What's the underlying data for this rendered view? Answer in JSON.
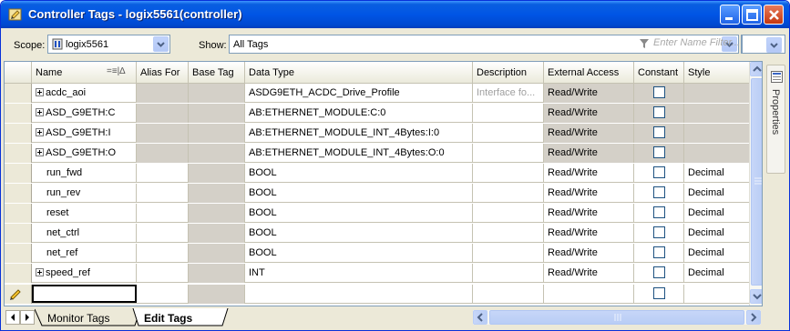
{
  "window": {
    "title": "Controller Tags - logix5561(controller)"
  },
  "toolbar": {
    "scope_label": "Scope:",
    "scope_value": "logix5561",
    "show_label": "Show:",
    "show_value": "All Tags",
    "filter_placeholder": "Enter Name Filter..."
  },
  "grid": {
    "columns": [
      "Name",
      "Alias For",
      "Base Tag",
      "Data Type",
      "Description",
      "External Access",
      "Constant",
      "Style"
    ],
    "rows": [
      {
        "name": "acdc_aoi",
        "expandable": true,
        "data_type": "ASDG9ETH_ACDC_Drive_Profile",
        "description": "Interface fo...",
        "external_access": "Read/Write",
        "constant": false,
        "style": ""
      },
      {
        "name": "ASD_G9ETH:C",
        "expandable": true,
        "data_type": "AB:ETHERNET_MODULE:C:0",
        "description": "",
        "external_access": "Read/Write",
        "constant": false,
        "style": ""
      },
      {
        "name": "ASD_G9ETH:I",
        "expandable": true,
        "data_type": "AB:ETHERNET_MODULE_INT_4Bytes:I:0",
        "description": "",
        "external_access": "Read/Write",
        "constant": false,
        "style": ""
      },
      {
        "name": "ASD_G9ETH:O",
        "expandable": true,
        "data_type": "AB:ETHERNET_MODULE_INT_4Bytes:O:0",
        "description": "",
        "external_access": "Read/Write",
        "constant": false,
        "style": ""
      },
      {
        "name": "run_fwd",
        "expandable": false,
        "data_type": "BOOL",
        "description": "",
        "external_access": "Read/Write",
        "constant": false,
        "style": "Decimal"
      },
      {
        "name": "run_rev",
        "expandable": false,
        "data_type": "BOOL",
        "description": "",
        "external_access": "Read/Write",
        "constant": false,
        "style": "Decimal"
      },
      {
        "name": "reset",
        "expandable": false,
        "data_type": "BOOL",
        "description": "",
        "external_access": "Read/Write",
        "constant": false,
        "style": "Decimal"
      },
      {
        "name": "net_ctrl",
        "expandable": false,
        "data_type": "BOOL",
        "description": "",
        "external_access": "Read/Write",
        "constant": false,
        "style": "Decimal"
      },
      {
        "name": "net_ref",
        "expandable": false,
        "data_type": "BOOL",
        "description": "",
        "external_access": "Read/Write",
        "constant": false,
        "style": "Decimal"
      },
      {
        "name": "speed_ref",
        "expandable": true,
        "data_type": "INT",
        "description": "",
        "external_access": "Read/Write",
        "constant": false,
        "style": "Decimal"
      }
    ]
  },
  "side_panel": {
    "properties_label": "Properties"
  },
  "tabs": {
    "monitor": "Monitor Tags",
    "edit": "Edit Tags"
  },
  "colors": {
    "titlebar": "#0055e5",
    "shaded_cell": "#d4d0c8",
    "window_bg": "#ece9d8"
  }
}
